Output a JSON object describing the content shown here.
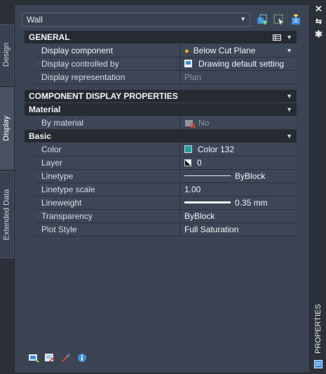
{
  "side_tabs": [
    "Design",
    "Display",
    "Extended Data"
  ],
  "right_bar": {
    "title": "PROPERTIES"
  },
  "selector": {
    "value": "Wall"
  },
  "sections": {
    "general": "GENERAL",
    "component_display": "COMPONENT DISPLAY PROPERTIES",
    "material": "Material",
    "basic": "Basic"
  },
  "general_rows": [
    {
      "name": "Display component",
      "value": "Below Cut Plane"
    },
    {
      "name": "Display controlled by",
      "value": "Drawing default setting"
    },
    {
      "name": "Display representation",
      "value": "Plan"
    }
  ],
  "material_rows": [
    {
      "name": "By material",
      "value": "No"
    }
  ],
  "basic_rows": [
    {
      "name": "Color",
      "value": "Color 132"
    },
    {
      "name": "Layer",
      "value": "0"
    },
    {
      "name": "Linetype",
      "value": "ByBlock"
    },
    {
      "name": "Linetype scale",
      "value": "1.00"
    },
    {
      "name": "Lineweight",
      "value": "0.35 mm"
    },
    {
      "name": "Transparency",
      "value": "ByBlock"
    },
    {
      "name": "Plot Style",
      "value": "Full Saturation"
    }
  ],
  "colors": {
    "color132": "#1fa59a",
    "accent": "#3b8de0"
  }
}
